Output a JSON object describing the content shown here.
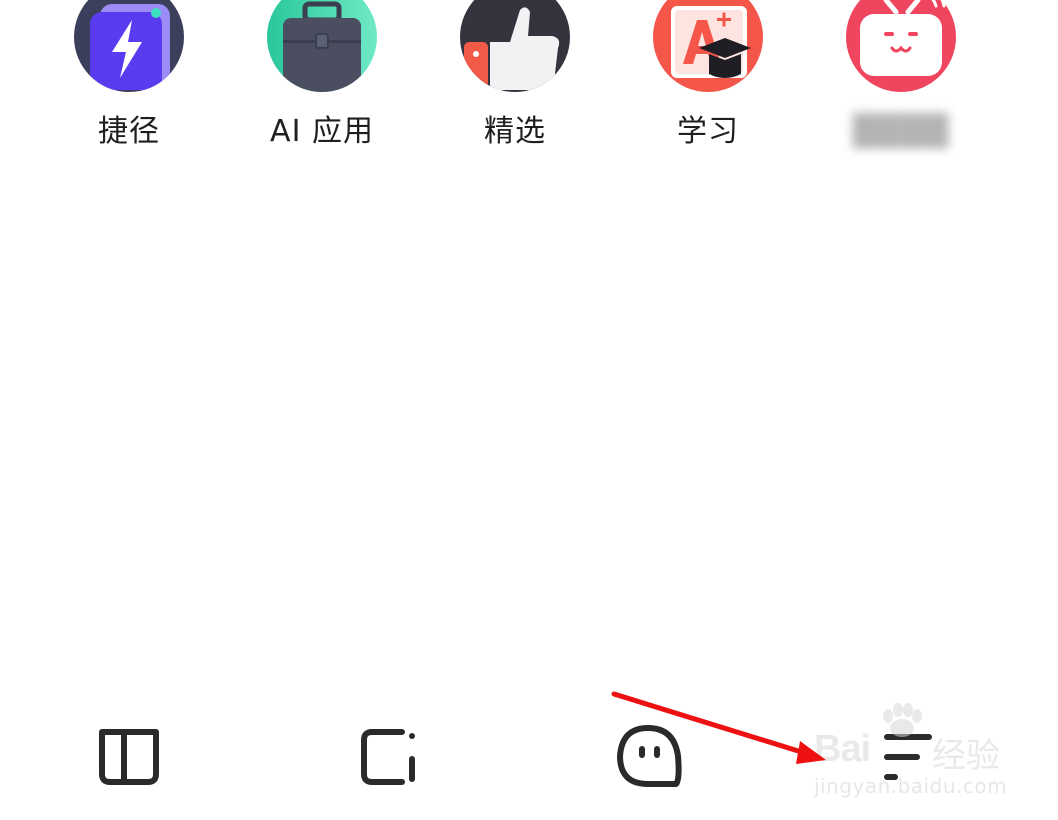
{
  "apps": [
    {
      "label": "捷径",
      "icon": "lightning-icon",
      "color": "#5b3df5"
    },
    {
      "label": "AI 应用",
      "icon": "briefcase-icon",
      "color": "#2fd3a0"
    },
    {
      "label": "精选",
      "icon": "thumbs-up-icon",
      "color": "#3a3a46"
    },
    {
      "label": "学习",
      "icon": "grade-a-plus-icon",
      "color": "#f5564a"
    },
    {
      "label": "",
      "icon": "tv-mascot-icon",
      "color": "#f0455f"
    }
  ],
  "bottom_nav": [
    {
      "icon": "book-icon"
    },
    {
      "icon": "square-icon"
    },
    {
      "icon": "chat-face-icon"
    },
    {
      "icon": "menu-icon"
    }
  ],
  "watermark": {
    "brand": "Bai",
    "cn": "经验",
    "url": "jingyan.baidu.com"
  },
  "annotation": {
    "color": "#ee1111"
  }
}
